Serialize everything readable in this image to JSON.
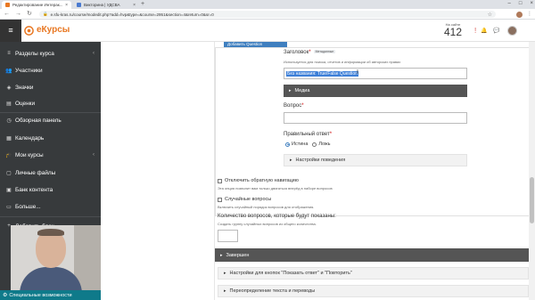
{
  "browser": {
    "tabs": [
      {
        "title": "Редактирование Интерак...",
        "active": true,
        "favicon_color": "#e87722"
      },
      {
        "title": "Викторина | УДСВА",
        "active": false,
        "favicon_color": "#4a7ad0"
      }
    ],
    "new_tab_glyph": "+",
    "tab_close_glyph": "×",
    "window_controls": [
      "–",
      "□",
      "×"
    ],
    "url": "e.sfu-kras.ru/course/modedit.php?add=hvp&type=&course=2951&section=4&return=0&sr=0",
    "nav_glyphs": [
      "←",
      "→",
      "↻"
    ],
    "star_glyph": "☆",
    "toolbar_icons": [
      "⋮"
    ]
  },
  "header": {
    "menu_glyph": "≡",
    "logo_text": "eКурсы",
    "counter_label": "На сайте",
    "counter_value": "412",
    "bell_glyph": "🔔",
    "alert_glyph": "!",
    "chat_glyph": "💬"
  },
  "sidebar": {
    "items": [
      {
        "label": "Разделы курса",
        "icon": "≡",
        "chevron": "‹"
      },
      {
        "label": "Участники",
        "icon": "👥",
        "chevron": ""
      },
      {
        "label": "Значки",
        "icon": "◈",
        "chevron": ""
      },
      {
        "label": "Оценки",
        "icon": "▤",
        "chevron": ""
      },
      {
        "label": "Обзорная панель",
        "icon": "◷",
        "chevron": ""
      },
      {
        "label": "Календарь",
        "icon": "▦",
        "chevron": ""
      },
      {
        "label": "Мои курсы",
        "icon": "🎓",
        "chevron": "‹"
      },
      {
        "label": "Личные файлы",
        "icon": "▢",
        "chevron": ""
      },
      {
        "label": "Банк контента",
        "icon": "▣",
        "chevron": ""
      },
      {
        "label": "Больше...",
        "icon": "▭",
        "chevron": ""
      },
      {
        "label": "Добавить блок",
        "icon": "+",
        "chevron": ""
      }
    ],
    "a11y_label": "Специальные возможности",
    "a11y_icon": "⚙"
  },
  "content": {
    "top_button": "Добавить Question",
    "title_label": "Заголовок",
    "title_badge": "Метаданные",
    "title_hint": "Используется для поиска, отчетов и информации об авторских правах",
    "title_value": "Без названия: True/False Question",
    "media_label": "Медиа",
    "question_label": "Вопрос",
    "correct_label": "Правильный ответ",
    "radio_true": "Истина",
    "radio_false": "Ложь",
    "behaviour_label": "Настройки поведения",
    "disable_nav_label": "Отключить обратную навигацию",
    "disable_nav_hint": "Эта опция позволит вам только двигаться вперёд в наборе вопросов",
    "random_label": "Случайные вопросы",
    "random_hint": "Включить случайный порядок вопросов для отображения.",
    "count_label": "Количество вопросов, которые будут показаны:",
    "count_hint": "Создать группу случайных вопросов из общего количества.",
    "finished_label": "Завершен",
    "buttons_label": "Настройки для кнопок \"Показать ответ\" и \"Повторить\"",
    "override_label": "Переопределение текста и переводы",
    "caret_right": "▸",
    "caret_down": "▾"
  },
  "colors": {
    "sidebar_bg": "#373a3c",
    "accent_blue": "#3f7fbf",
    "logo_orange": "#e87722",
    "dark_bar": "#555555",
    "a11y_bar": "#0f7a8a"
  }
}
